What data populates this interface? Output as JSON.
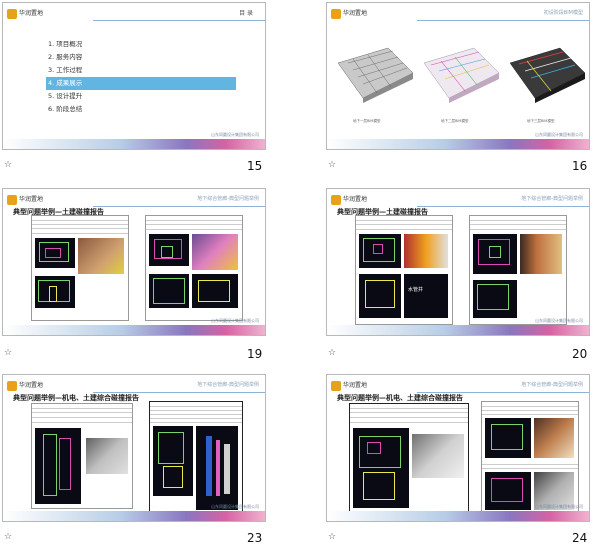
{
  "slides": [
    {
      "number": "15",
      "toc_title": "目 录",
      "toc_items": [
        "1.  项目概况",
        "2.  服务内容",
        "3.  工作过程",
        "4.  成果展示",
        "5.  设计提升",
        "6.  阶段总结"
      ],
      "active_index": 3,
      "footer": "山东同圆设计集团有限公司"
    },
    {
      "number": "16",
      "header": "初设阶段BIM模型",
      "captions": [
        "地下一层BIM模型",
        "地下二层BIM模型",
        "地下三层BIM模型"
      ],
      "footer": "山东同圆设计集团有限公司"
    },
    {
      "number": "19",
      "header": "地下综合管廊-典型问题举例",
      "title": "典型问题举例—土建碰撞报告",
      "footer": "山东同圆设计集团有限公司"
    },
    {
      "number": "20",
      "header": "地下综合管廊-典型问题举例",
      "title": "典型问题举例—土建碰撞报告",
      "label": "水管井",
      "footer": "山东同圆设计集团有限公司"
    },
    {
      "number": "23",
      "header": "地下综合管廊-典型问题举例",
      "title": "典型问题举例—机电、土建综合碰撞报告",
      "footer": "山东同圆设计集团有限公司"
    },
    {
      "number": "24",
      "header": "地下综合管廊-典型问题举例",
      "title": "典型问题举例—机电、土建综合碰撞报告",
      "footer": "山东同圆设计集团有限公司"
    }
  ],
  "logo_text": "华润置地",
  "star_icon": "star-icon",
  "colors": {
    "accent": "#62b5e0",
    "logo": "#e8a21a"
  }
}
